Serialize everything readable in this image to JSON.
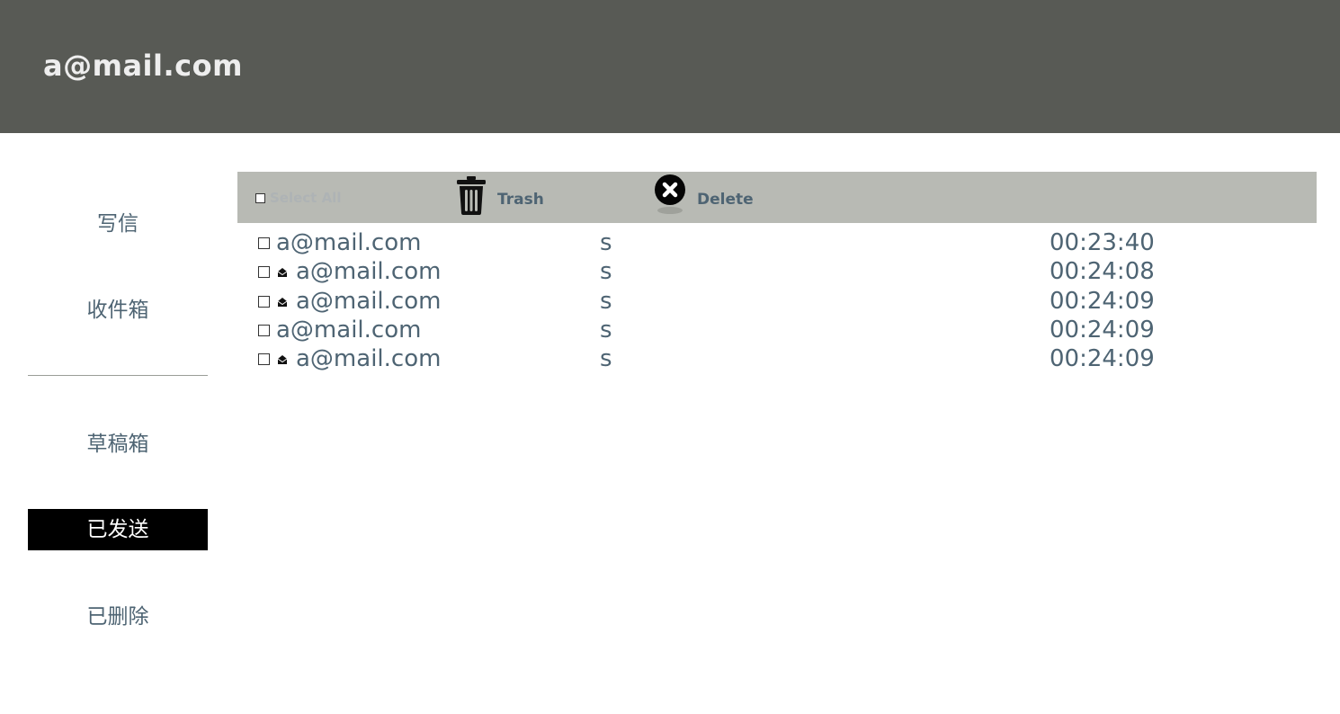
{
  "header": {
    "account": "a@mail.com"
  },
  "sidebar": {
    "items": [
      {
        "label": "写信",
        "active": false
      },
      {
        "label": "收件箱",
        "active": false
      },
      {
        "label": "草稿箱",
        "active": false
      },
      {
        "label": "已发送",
        "active": true
      },
      {
        "label": "已删除",
        "active": false
      }
    ]
  },
  "toolbar": {
    "select_all_label": "Select All",
    "trash_label": "Trash",
    "trash_icon": "trash-can-icon",
    "delete_label": "Delete",
    "delete_icon": "close-circle-icon"
  },
  "mails": [
    {
      "from": "a@mail.com",
      "subject": "s",
      "time": "00:23:40",
      "icon": ""
    },
    {
      "from": "a@mail.com",
      "subject": "s",
      "time": "00:24:08",
      "icon": "envelope-icon"
    },
    {
      "from": "a@mail.com",
      "subject": "s",
      "time": "00:24:09",
      "icon": "envelope-icon"
    },
    {
      "from": "a@mail.com",
      "subject": "s",
      "time": "00:24:09",
      "icon": ""
    },
    {
      "from": "a@mail.com",
      "subject": "s",
      "time": "00:24:09",
      "icon": "envelope-icon"
    }
  ],
  "colors": {
    "header_bg": "#585a55",
    "toolbar_bg": "#b8bab4",
    "text": "#4e6473",
    "active_bg": "#000000"
  }
}
